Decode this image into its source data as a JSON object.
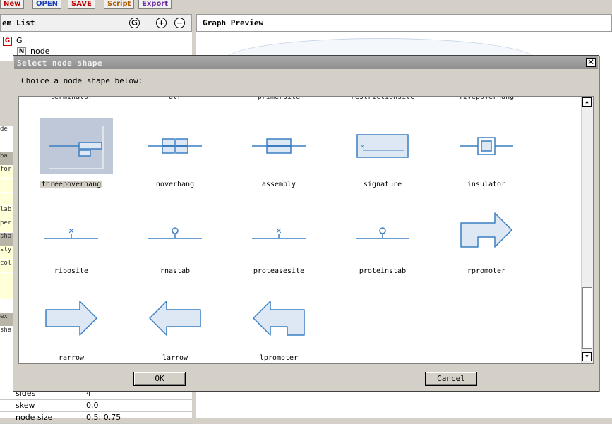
{
  "toolbar": {
    "new_label": "New",
    "open_label": "OPEN",
    "save_label": "SAVE",
    "script_label": "Script",
    "export_label": "Export"
  },
  "left_panel": {
    "title": "em List",
    "btn_g": "G",
    "btn_plus": "+",
    "btn_minus": "−",
    "tree": [
      {
        "badge": "G",
        "label": "G"
      },
      {
        "badge": "N",
        "label": "node"
      }
    ],
    "strip": [
      "de",
      "",
      "ba",
      "for",
      "",
      "",
      "lab",
      "per",
      "sha",
      "sty",
      "col",
      "",
      "",
      "",
      "ex",
      "sha"
    ],
    "properties": [
      {
        "key": "sides",
        "value": "4"
      },
      {
        "key": "skew",
        "value": "0.0"
      },
      {
        "key": "node size",
        "value": "0.5; 0.75"
      }
    ]
  },
  "right_panel": {
    "title": "Graph Preview"
  },
  "dialog": {
    "title": "Select node shape",
    "close": "✕",
    "instruction": "Choice a node shape below:",
    "partial_row": [
      "terminator",
      "utr",
      "primersite",
      "restrictionsite",
      "fivepoverhang"
    ],
    "shapes": [
      {
        "id": "threepoverhang",
        "label": "threepoverhang",
        "selected": true
      },
      {
        "id": "noverhang",
        "label": "noverhang"
      },
      {
        "id": "assembly",
        "label": "assembly"
      },
      {
        "id": "signature",
        "label": "signature"
      },
      {
        "id": "insulator",
        "label": "insulator"
      },
      {
        "id": "ribosite",
        "label": "ribosite"
      },
      {
        "id": "rnastab",
        "label": "rnastab"
      },
      {
        "id": "proteasesite",
        "label": "proteasesite"
      },
      {
        "id": "proteinstab",
        "label": "proteinstab"
      },
      {
        "id": "rpromoter",
        "label": "rpromoter"
      },
      {
        "id": "rarrow",
        "label": "rarrow"
      },
      {
        "id": "larrow",
        "label": "larrow"
      },
      {
        "id": "lpromoter",
        "label": "lpromoter"
      }
    ],
    "ok_label": "OK",
    "cancel_label": "Cancel"
  },
  "colors": {
    "shape_stroke": "#3a7fc1",
    "shape_fill": "#dde8f4",
    "selected_bg": "#bfc8d9",
    "titlebar": "#999999"
  }
}
